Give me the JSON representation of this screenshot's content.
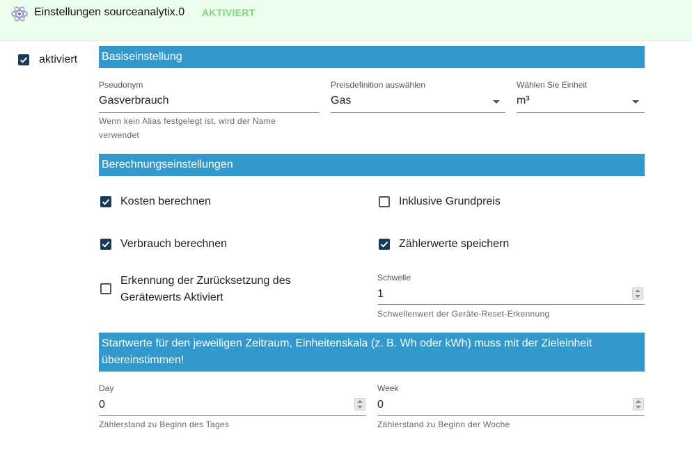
{
  "header": {
    "title": "Einstellungen sourceanalytix.0",
    "status": "AKTIVIERT"
  },
  "enabled": {
    "label": "aktiviert",
    "checked": true
  },
  "sections": {
    "basic": "Basiseinstellung",
    "calculation": "Berechnungseinstellungen",
    "start_values": "Startwerte für den jeweiligen Zeitraum, Einheitenskala (z. B. Wh oder kWh) muss mit der Zieleinheit übereinstimmen!"
  },
  "basic": {
    "pseudonym": {
      "label": "Pseudonym",
      "value": "Gasverbrauch",
      "helper": "Wenn kein Alias festgelegt ist, wird der Name verwendet"
    },
    "price": {
      "label": "Preisdefinition auswählen",
      "value": "Gas"
    },
    "unit": {
      "label": "Wählen Sie Einheit",
      "value": "m³"
    }
  },
  "calc": {
    "costs": {
      "label": "Kosten berechnen",
      "checked": true
    },
    "base_price": {
      "label": "Inklusive Grundpreis",
      "checked": false
    },
    "consumption": {
      "label": "Verbrauch berechnen",
      "checked": true
    },
    "meter_values": {
      "label": "Zählerwerte speichern",
      "checked": true
    },
    "reset_detection": {
      "label": "Erkennung der Zurücksetzung des Gerätewerts Aktiviert",
      "checked": false
    },
    "threshold": {
      "label": "Schwelle",
      "value": "1",
      "helper": "Schwellenwert der Geräte-Reset-Erkennung"
    }
  },
  "start": {
    "day": {
      "label": "Day",
      "value": "0",
      "helper": "Zählerstand zu Beginn des Tages"
    },
    "week": {
      "label": "Week",
      "value": "0",
      "helper": "Zählerstand zu Beginn der Woche"
    }
  },
  "colors": {
    "header_bg": "#ecfdec",
    "status_green": "#7ed67e",
    "section_blue": "#3399cc",
    "checkbox_checked": "#1a3a5c"
  }
}
